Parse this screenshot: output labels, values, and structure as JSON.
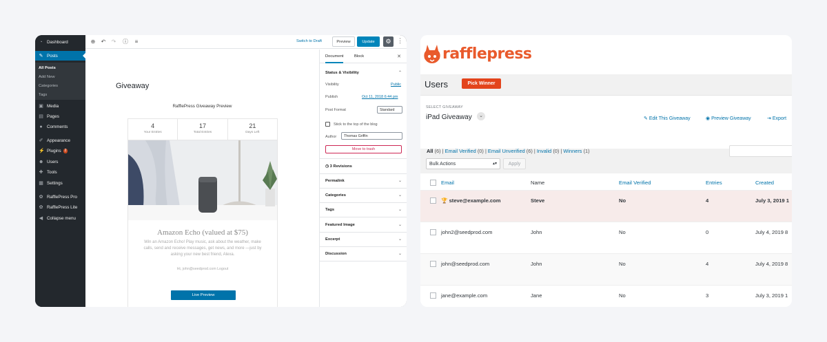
{
  "wp_sidebar": {
    "items": [
      {
        "label": "Dashboard",
        "icon": "dashboard-icon"
      },
      {
        "label": "Posts",
        "icon": "pin-icon"
      },
      {
        "label": "Media",
        "icon": "media-icon"
      },
      {
        "label": "Pages",
        "icon": "pages-icon"
      },
      {
        "label": "Comments",
        "icon": "comment-icon"
      },
      {
        "label": "Appearance",
        "icon": "brush-icon"
      },
      {
        "label": "Plugins",
        "icon": "plug-icon",
        "badge": "2"
      },
      {
        "label": "Users",
        "icon": "users-icon"
      },
      {
        "label": "Tools",
        "icon": "wrench-icon"
      },
      {
        "label": "Settings",
        "icon": "settings-icon"
      },
      {
        "label": "RafflePress Pro",
        "icon": "rafflepress-icon"
      },
      {
        "label": "RafflePress Lite",
        "icon": "rafflepress-icon"
      },
      {
        "label": "Collapse menu",
        "icon": "collapse-icon"
      }
    ],
    "submenu": [
      "All Posts",
      "Add New",
      "Categories",
      "Tags"
    ]
  },
  "editor": {
    "toolbar": {
      "switch_draft": "Switch to Draft",
      "preview": "Preview",
      "update": "Update"
    },
    "post_title": "Giveaway",
    "preview_heading": "RafflePress Giveaway Preview",
    "stats": [
      {
        "value": "4",
        "label": "Your Entries"
      },
      {
        "value": "17",
        "label": "Total Entries"
      },
      {
        "value": "21",
        "label": "Days Left"
      }
    ],
    "prize_title": "Amazon Echo (valued at $75)",
    "prize_desc": "Win an Amazon Echo! Play music, ask about the weather, make calls, send and receive messages, get news, and more —just by asking your new best friend, Alexa.",
    "greeting": "Hi, john@seedprod.com Logout",
    "live_preview": "Live Preview"
  },
  "settings": {
    "tabs": [
      "Document",
      "Block"
    ],
    "status_visibility": "Status & Visibility",
    "visibility_label": "Visibility",
    "visibility_value": "Public",
    "publish_label": "Publish",
    "publish_value": "Oct 11, 2018 6:44 pm",
    "post_format_label": "Post Format",
    "post_format_value": "Standard",
    "sticky_label": "Stick to the top of the blog",
    "author_label": "Author",
    "author_value": "Thomas Griffin",
    "trash": "Move to trash",
    "revisions": "3 Revisions",
    "panels": [
      "Permalink",
      "Categories",
      "Tags",
      "Featured Image",
      "Excerpt",
      "Discussion"
    ]
  },
  "rafflepress": {
    "brand": "rafflepress",
    "brand_color": "#e95a2c",
    "page_title": "Users",
    "pick_winner": "Pick Winner",
    "select_label": "SELECT GIVEAWAY",
    "giveaway_name": "iPad Giveaway",
    "actions": [
      "Edit This Giveaway",
      "Preview Giveaway",
      "Export"
    ],
    "filters": {
      "all": "All",
      "all_count": "(6)",
      "verified": "Email Verified",
      "verified_count": "(0)",
      "unverified": "Email Unverified",
      "unverified_count": "(6)",
      "invalid": "Invalid",
      "invalid_count": "(0)",
      "winners": "Winners",
      "winners_count": "(1)"
    },
    "bulk_actions": "Bulk Actions",
    "apply": "Apply",
    "columns": [
      "Email",
      "Name",
      "Email Verified",
      "Entries",
      "Created"
    ],
    "rows": [
      {
        "email": "steve@example.com",
        "name": "Steve",
        "verified": "No",
        "entries": "4",
        "created": "July 3, 2019 1",
        "winner": true
      },
      {
        "email": "john2@seedprod.com",
        "name": "John",
        "verified": "No",
        "entries": "0",
        "created": "July 4, 2019 8",
        "winner": false
      },
      {
        "email": "john@seedprod.com",
        "name": "John",
        "verified": "No",
        "entries": "4",
        "created": "July 4, 2019 8",
        "winner": false
      },
      {
        "email": "jane@example.com",
        "name": "Jane",
        "verified": "No",
        "entries": "3",
        "created": "July 3, 2019 1",
        "winner": false
      }
    ]
  }
}
